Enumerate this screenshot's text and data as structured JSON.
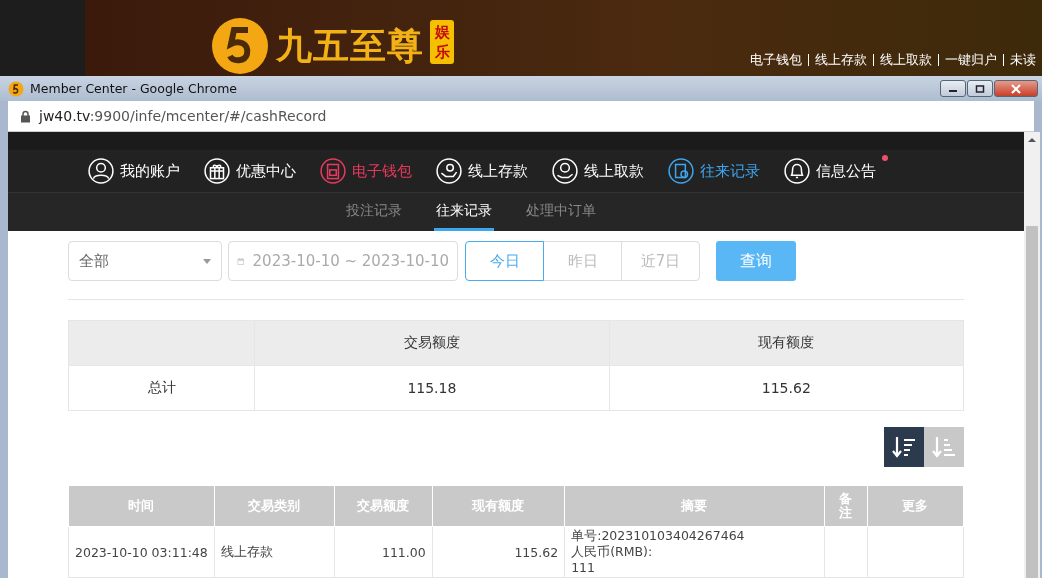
{
  "site": {
    "logo_text": "九五至尊",
    "logo_badge": "娱乐",
    "links": [
      "电子钱包",
      "线上存款",
      "线上取款",
      "一键归户",
      "未读"
    ]
  },
  "window": {
    "title": "Member Center - Google Chrome",
    "url_host": "jw40.tv",
    "url_rest": ":9900/infe/mcenter/#/cashRecord"
  },
  "nav": [
    {
      "label": "我的账户",
      "kind": "normal",
      "selected": false,
      "badge": false
    },
    {
      "label": "优惠中心",
      "kind": "normal",
      "selected": false,
      "badge": false
    },
    {
      "label": "电子钱包",
      "kind": "hot",
      "selected": false,
      "badge": false
    },
    {
      "label": "线上存款",
      "kind": "normal",
      "selected": false,
      "badge": false
    },
    {
      "label": "线上取款",
      "kind": "normal",
      "selected": false,
      "badge": false
    },
    {
      "label": "往来记录",
      "kind": "normal",
      "selected": true,
      "badge": false
    },
    {
      "label": "信息公告",
      "kind": "normal",
      "selected": false,
      "badge": true
    }
  ],
  "subtabs": [
    {
      "label": "投注记录",
      "selected": false
    },
    {
      "label": "往来记录",
      "selected": true
    },
    {
      "label": "处理中订单",
      "selected": false
    }
  ],
  "filter": {
    "type_value": "全部",
    "date_value": "2023-10-10 ~ 2023-10-10",
    "ranges": [
      {
        "label": "今日",
        "selected": true
      },
      {
        "label": "昨日",
        "selected": false
      },
      {
        "label": "近7日",
        "selected": false
      }
    ],
    "query": "查询"
  },
  "summary": {
    "columns": [
      "交易额度",
      "现有额度"
    ],
    "row": {
      "label": "总计",
      "values": [
        "115.18",
        "115.62"
      ]
    }
  },
  "sort": [
    {
      "kind": "desc",
      "selected": true
    },
    {
      "kind": "asc",
      "selected": false
    }
  ],
  "table": {
    "columns": [
      "时间",
      "交易类别",
      "交易额度",
      "现有额度",
      "摘要",
      "备注",
      "更多"
    ],
    "rows": [
      {
        "time": "2023-10-10 03:11:48",
        "type": "线上存款",
        "amount": "111.00",
        "balance": "115.62",
        "summary": [
          "单号:202310103404267464",
          "人民币(RMB):",
          "111"
        ]
      }
    ]
  }
}
